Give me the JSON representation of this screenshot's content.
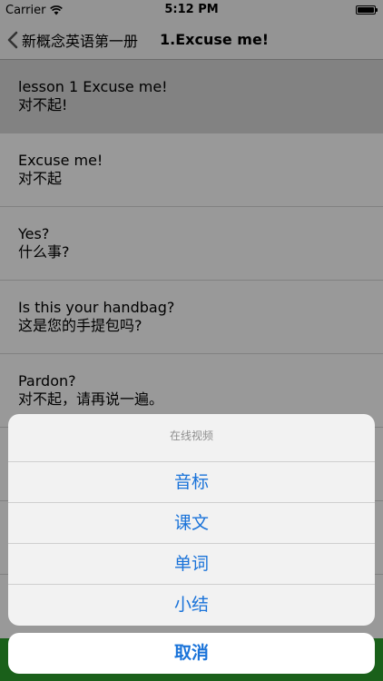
{
  "status_bar": {
    "carrier": "Carrier",
    "time": "5:12 PM"
  },
  "nav": {
    "back_label": "新概念英语第一册",
    "title": "1.Excuse me!"
  },
  "rows": [
    {
      "en": "lesson 1 Excuse me!",
      "zh": "对不起!"
    },
    {
      "en": "Excuse me!",
      "zh": "对不起"
    },
    {
      "en": "Yes?",
      "zh": "什么事?"
    },
    {
      "en": "Is this your handbag?",
      "zh": "这是您的手提包吗?"
    },
    {
      "en": "Pardon?",
      "zh": "对不起，请再说一遍。"
    }
  ],
  "action_sheet": {
    "title": "在线视频",
    "items": [
      "音标",
      "课文",
      "单词",
      "小结"
    ],
    "cancel": "取消"
  },
  "tab_bar": {
    "color": "#2ca02c"
  },
  "colors": {
    "action_text": "#1a73d9",
    "selected_row": "#d9d9d9"
  }
}
